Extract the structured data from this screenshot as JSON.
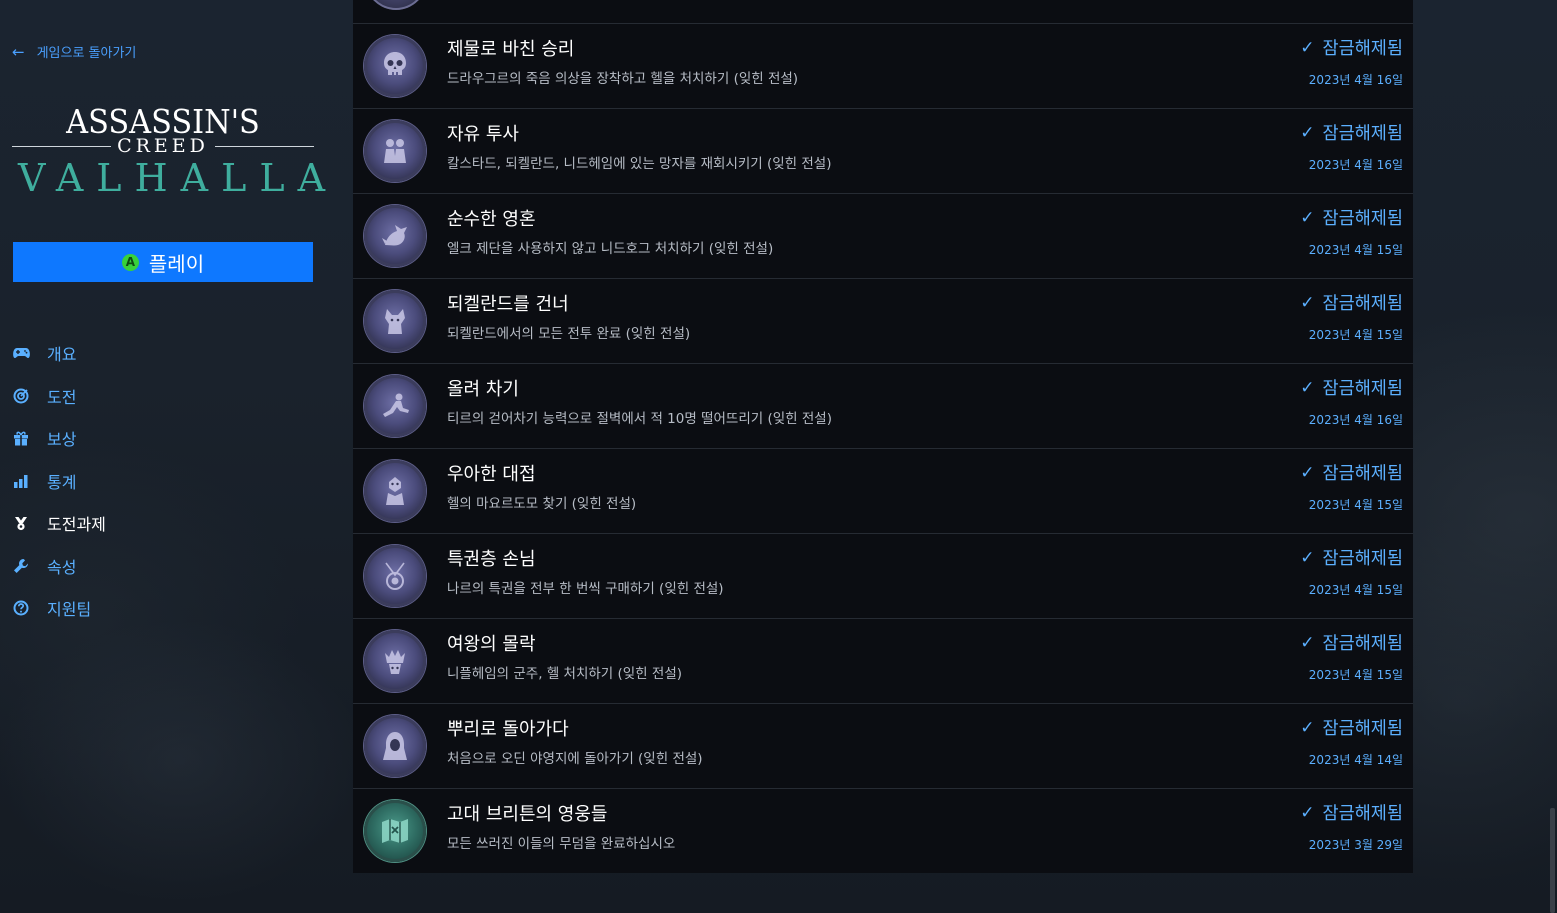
{
  "sidebar": {
    "back_label": "게임으로 돌아가기",
    "logo": {
      "line1": "ASSASSIN'S",
      "line2": "CREED",
      "line3": "VALHALLA"
    },
    "play_label": "플레이",
    "play_badge": "A",
    "nav": [
      {
        "label": "개요",
        "icon": "gamepad-icon",
        "active": false
      },
      {
        "label": "도전",
        "icon": "target-icon",
        "active": false
      },
      {
        "label": "보상",
        "icon": "gift-icon",
        "active": false
      },
      {
        "label": "통계",
        "icon": "bar-chart-icon",
        "active": false
      },
      {
        "label": "도전과제",
        "icon": "trophy-icon",
        "active": true
      },
      {
        "label": "속성",
        "icon": "wrench-icon",
        "active": false
      },
      {
        "label": "지원팀",
        "icon": "help-icon",
        "active": false
      }
    ]
  },
  "achievements": [
    {
      "title": "제물로 바친 승리",
      "description": "드라우그르의 죽음 의상을 장착하고 헬을 처치하기 (잊힌 전설)",
      "status": "잠금해제됨",
      "date": "2023년 4월 16일",
      "emblem": "skull-emblem-icon"
    },
    {
      "title": "자유 투사",
      "description": "칼스타드, 되켈란드, 니드헤임에 있는 망자를 재회시키기 (잊힌 전설)",
      "status": "잠금해제됨",
      "date": "2023년 4월 16일",
      "emblem": "figures-emblem-icon"
    },
    {
      "title": "순수한 영혼",
      "description": "엘크 제단을 사용하지 않고 니드호그 처치하기 (잊힌 전설)",
      "status": "잠금해제됨",
      "date": "2023년 4월 15일",
      "emblem": "dragon-emblem-icon"
    },
    {
      "title": "되켈란드를 건너",
      "description": "되켈란드에서의 모든 전투 완료 (잊힌 전설)",
      "status": "잠금해제됨",
      "date": "2023년 4월 15일",
      "emblem": "wolf-emblem-icon"
    },
    {
      "title": "올려 차기",
      "description": "티르의 걷어차기 능력으로 절벽에서 적 10명 떨어뜨리기 (잊힌 전설)",
      "status": "잠금해제됨",
      "date": "2023년 4월 16일",
      "emblem": "kick-emblem-icon"
    },
    {
      "title": "우아한 대접",
      "description": "헬의 마요르도모 찾기 (잊힌 전설)",
      "status": "잠금해제됨",
      "date": "2023년 4월 15일",
      "emblem": "servant-emblem-icon"
    },
    {
      "title": "특권층 손님",
      "description": "나르의 특권을 전부 한 번씩 구매하기 (잊힌 전설)",
      "status": "잠금해제됨",
      "date": "2023년 4월 15일",
      "emblem": "pendant-emblem-icon"
    },
    {
      "title": "여왕의 몰락",
      "description": "니플헤임의 군주, 헬 처치하기 (잊힌 전설)",
      "status": "잠금해제됨",
      "date": "2023년 4월 15일",
      "emblem": "queen-emblem-icon"
    },
    {
      "title": "뿌리로 돌아가다",
      "description": "처음으로 오딘 야영지에 돌아가기 (잊힌 전설)",
      "status": "잠금해제됨",
      "date": "2023년 4월 14일",
      "emblem": "hooded-emblem-icon"
    },
    {
      "title": "고대 브리튼의 영웅들",
      "description": "모든 쓰러진 이들의 무덤을 완료하십시오",
      "status": "잠금해제됨",
      "date": "2023년 3월 29일",
      "emblem": "map-emblem-icon"
    }
  ],
  "colors": {
    "accent": "#0e78ff",
    "link": "#5cb0ff",
    "valhalla": "#3fae9e",
    "list_bg": "#0b0d12"
  }
}
